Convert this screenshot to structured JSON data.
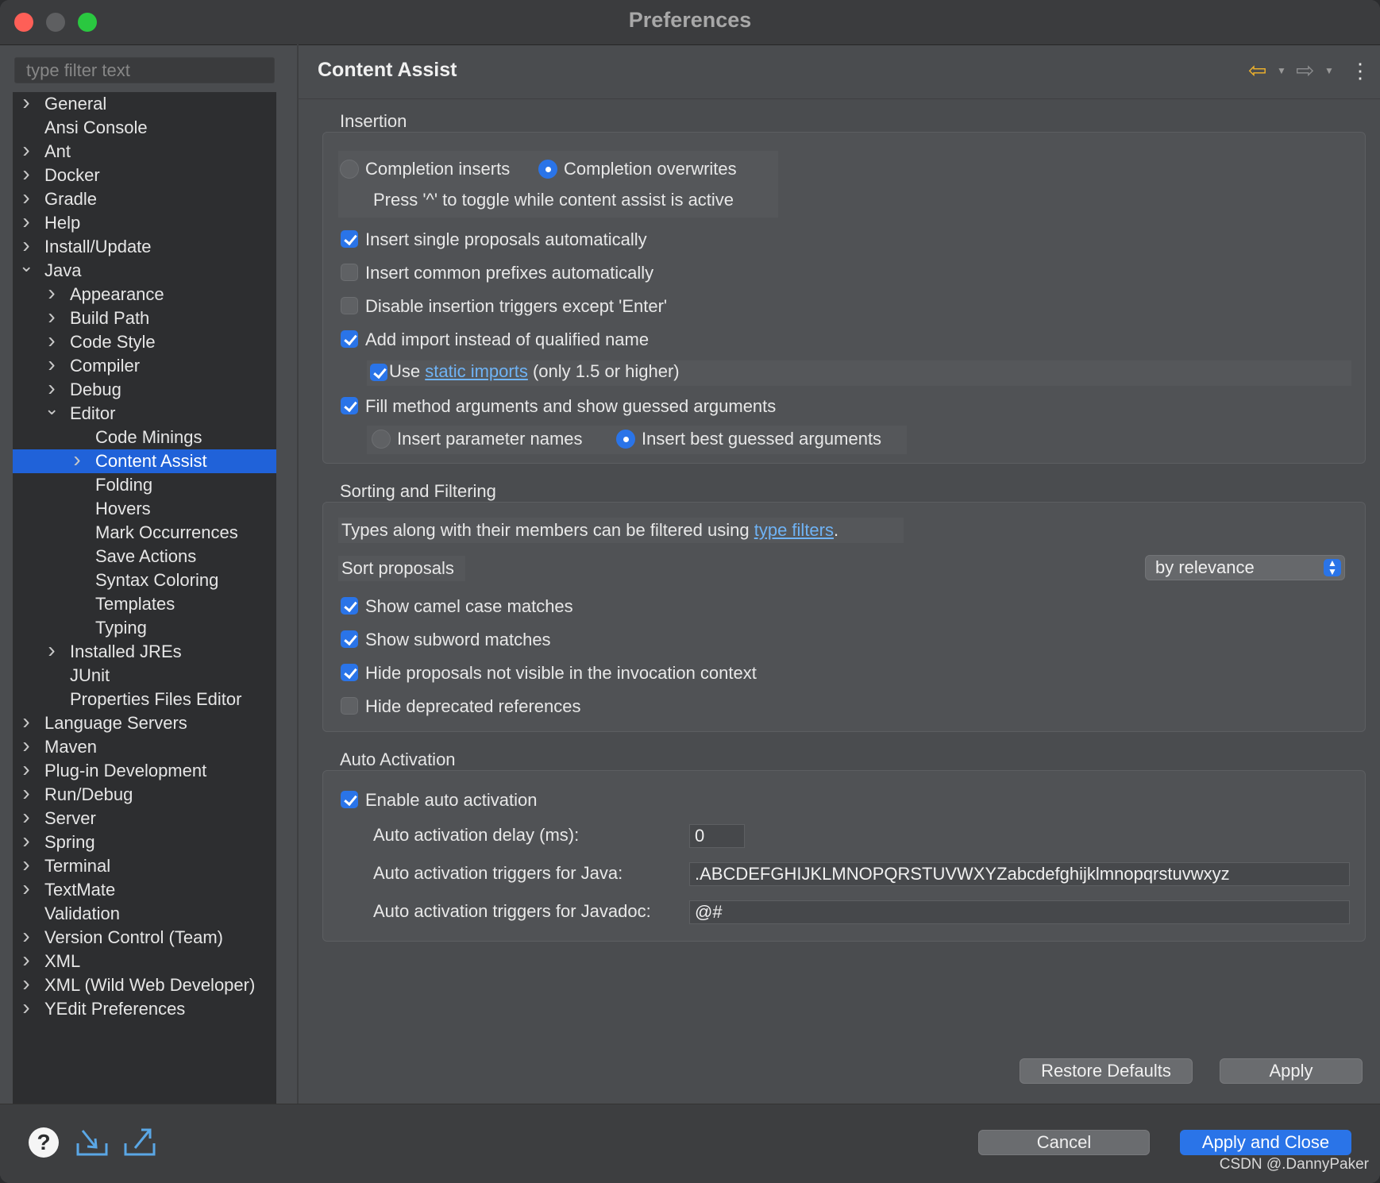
{
  "window": {
    "title": "Preferences"
  },
  "sidebar": {
    "filter_placeholder": "type filter text",
    "items": [
      {
        "label": "General",
        "depth": 0,
        "expander": "collapsed"
      },
      {
        "label": "Ansi Console",
        "depth": 0,
        "expander": "none"
      },
      {
        "label": "Ant",
        "depth": 0,
        "expander": "collapsed"
      },
      {
        "label": "Docker",
        "depth": 0,
        "expander": "collapsed"
      },
      {
        "label": "Gradle",
        "depth": 0,
        "expander": "collapsed"
      },
      {
        "label": "Help",
        "depth": 0,
        "expander": "collapsed"
      },
      {
        "label": "Install/Update",
        "depth": 0,
        "expander": "collapsed"
      },
      {
        "label": "Java",
        "depth": 0,
        "expander": "expanded"
      },
      {
        "label": "Appearance",
        "depth": 1,
        "expander": "collapsed"
      },
      {
        "label": "Build Path",
        "depth": 1,
        "expander": "collapsed"
      },
      {
        "label": "Code Style",
        "depth": 1,
        "expander": "collapsed"
      },
      {
        "label": "Compiler",
        "depth": 1,
        "expander": "collapsed"
      },
      {
        "label": "Debug",
        "depth": 1,
        "expander": "collapsed"
      },
      {
        "label": "Editor",
        "depth": 1,
        "expander": "expanded"
      },
      {
        "label": "Code Minings",
        "depth": 2,
        "expander": "none"
      },
      {
        "label": "Content Assist",
        "depth": 2,
        "expander": "collapsed",
        "selected": true
      },
      {
        "label": "Folding",
        "depth": 2,
        "expander": "none"
      },
      {
        "label": "Hovers",
        "depth": 2,
        "expander": "none"
      },
      {
        "label": "Mark Occurrences",
        "depth": 2,
        "expander": "none"
      },
      {
        "label": "Save Actions",
        "depth": 2,
        "expander": "none"
      },
      {
        "label": "Syntax Coloring",
        "depth": 2,
        "expander": "none"
      },
      {
        "label": "Templates",
        "depth": 2,
        "expander": "none"
      },
      {
        "label": "Typing",
        "depth": 2,
        "expander": "none"
      },
      {
        "label": "Installed JREs",
        "depth": 1,
        "expander": "collapsed"
      },
      {
        "label": "JUnit",
        "depth": 1,
        "expander": "none"
      },
      {
        "label": "Properties Files Editor",
        "depth": 1,
        "expander": "none"
      },
      {
        "label": "Language Servers",
        "depth": 0,
        "expander": "collapsed"
      },
      {
        "label": "Maven",
        "depth": 0,
        "expander": "collapsed"
      },
      {
        "label": "Plug-in Development",
        "depth": 0,
        "expander": "collapsed"
      },
      {
        "label": "Run/Debug",
        "depth": 0,
        "expander": "collapsed"
      },
      {
        "label": "Server",
        "depth": 0,
        "expander": "collapsed"
      },
      {
        "label": "Spring",
        "depth": 0,
        "expander": "collapsed"
      },
      {
        "label": "Terminal",
        "depth": 0,
        "expander": "collapsed"
      },
      {
        "label": "TextMate",
        "depth": 0,
        "expander": "collapsed"
      },
      {
        "label": "Validation",
        "depth": 0,
        "expander": "none"
      },
      {
        "label": "Version Control (Team)",
        "depth": 0,
        "expander": "collapsed"
      },
      {
        "label": "XML",
        "depth": 0,
        "expander": "collapsed"
      },
      {
        "label": "XML (Wild Web Developer)",
        "depth": 0,
        "expander": "collapsed"
      },
      {
        "label": "YEdit Preferences",
        "depth": 0,
        "expander": "collapsed"
      }
    ]
  },
  "page": {
    "title": "Content Assist"
  },
  "insertion": {
    "label": "Insertion",
    "completion_inserts": "Completion inserts",
    "completion_overwrites": "Completion overwrites",
    "toggle_hint": "Press '^' to toggle while content assist is active",
    "insert_single": "Insert single proposals automatically",
    "insert_common": "Insert common prefixes automatically",
    "disable_triggers": "Disable insertion triggers except 'Enter'",
    "add_import": "Add import instead of qualified name",
    "use_prefix": "Use",
    "static_imports_link": "static imports",
    "use_suffix": "(only 1.5 or higher)",
    "fill_args": "Fill method arguments and show guessed arguments",
    "insert_param_names": "Insert parameter names",
    "insert_best_guessed": "Insert best guessed arguments"
  },
  "sorting": {
    "label": "Sorting and Filtering",
    "types_text": "Types along with their members can be filtered using",
    "type_filters_link": "type filters",
    "period": ".",
    "sort_label": "Sort proposals",
    "sort_value": "by relevance",
    "camel_case": "Show camel case matches",
    "subword": "Show subword matches",
    "hide_not_visible": "Hide proposals not visible in the invocation context",
    "hide_deprecated": "Hide deprecated references"
  },
  "auto": {
    "label": "Auto Activation",
    "enable": "Enable auto activation",
    "delay_label": "Auto activation delay (ms):",
    "delay_value": "0",
    "java_label": "Auto activation triggers for Java:",
    "java_value": ".ABCDEFGHIJKLMNOPQRSTUVWXYZabcdefghijklmnopqrstuvwxyz",
    "javadoc_label": "Auto activation triggers for Javadoc:",
    "javadoc_value": "@#"
  },
  "buttons": {
    "restore_defaults": "Restore Defaults",
    "apply": "Apply",
    "cancel": "Cancel",
    "apply_close": "Apply and Close"
  },
  "watermark": "CSDN @.DannyPaker"
}
